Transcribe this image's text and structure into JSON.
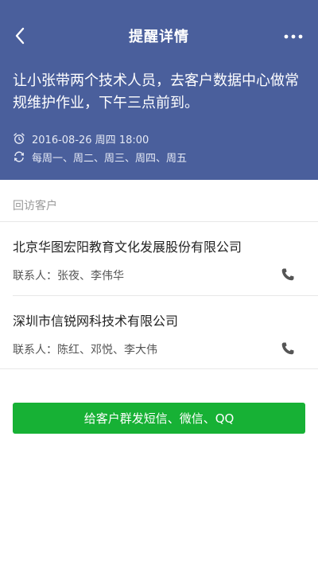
{
  "nav": {
    "title": "提醒详情",
    "back_icon": "chevron-left-icon",
    "more_icon": "more-horizontal-icon"
  },
  "reminder": {
    "text": "让小张带两个技术人员，去客户数据中心做常规维护作业，下午三点前到。",
    "datetime": "2016-08-26 周四 18:00",
    "repeat": "每周一、周二、周三、周四、周五",
    "datetime_icon": "alarm-clock-icon",
    "repeat_icon": "repeat-icon"
  },
  "section": {
    "label": "回访客户"
  },
  "customers": [
    {
      "name": "北京华图宏阳教育文化发展股份有限公司",
      "contacts": "联系人：张夜、李伟华"
    },
    {
      "name": "深圳市信锐网科技术有限公司",
      "contacts": "联系人：陈红、邓悦、李大伟"
    }
  ],
  "actions": {
    "send_label": "给客户群发短信、微信、QQ"
  },
  "colors": {
    "header_bg": "#4a5f9c",
    "button_bg": "#17b135",
    "phone_icon": "#555555"
  }
}
